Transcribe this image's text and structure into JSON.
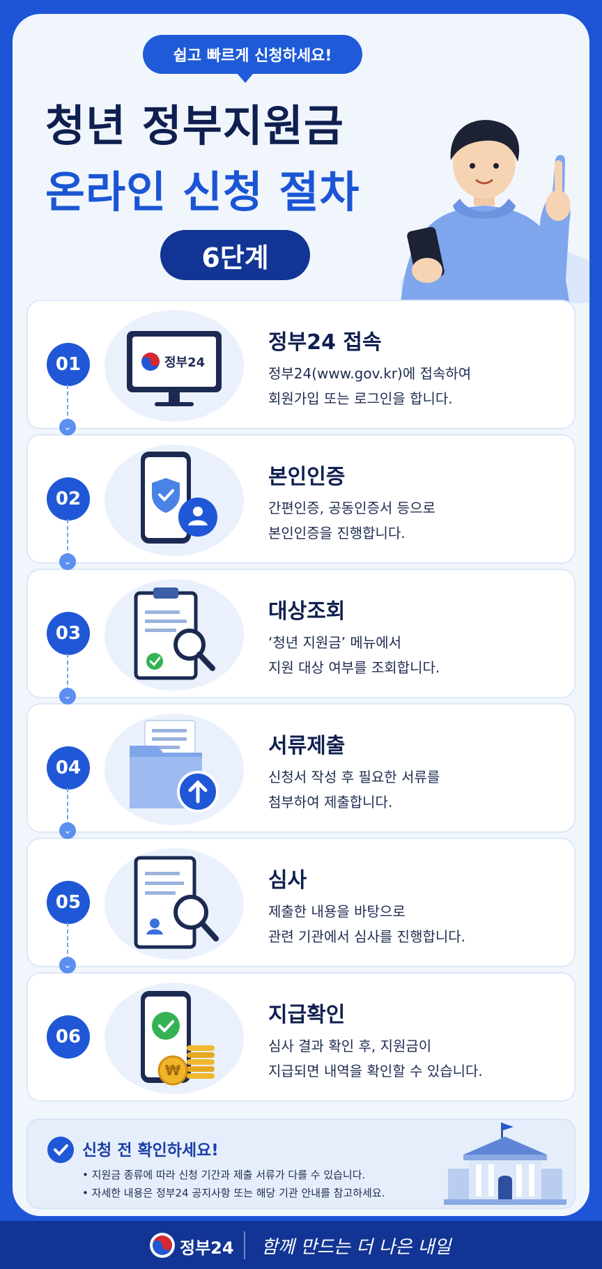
{
  "header": {
    "bubble": "쉽고 빠르게 신청하세요!",
    "title_line1": "청년 정부지원금",
    "title_line2": "온라인 신청 절차",
    "step_count": "6단계"
  },
  "steps": [
    {
      "num": "01",
      "title": "정부24 접속",
      "desc1": "정부24(www.gov.kr)에 접속하여",
      "desc2": "회원가입 또는 로그인을 합니다.",
      "icon": "monitor-icon",
      "screen_text": "정부24"
    },
    {
      "num": "02",
      "title": "본인인증",
      "desc1": "간편인증, 공동인증서 등으로",
      "desc2": "본인인증을 진행합니다.",
      "icon": "phone-shield-icon"
    },
    {
      "num": "03",
      "title": "대상조회",
      "desc1": "‘청년 지원금’ 메뉴에서",
      "desc2": "지원 대상 여부를 조회합니다.",
      "icon": "clipboard-search-icon"
    },
    {
      "num": "04",
      "title": "서류제출",
      "desc1": "신청서 작성 후 필요한 서류를",
      "desc2": "첨부하여 제출합니다.",
      "icon": "folder-upload-icon"
    },
    {
      "num": "05",
      "title": "심사",
      "desc1": "제출한 내용을 바탕으로",
      "desc2": "관련 기관에서 심사를 진행합니다.",
      "icon": "document-search-icon"
    },
    {
      "num": "06",
      "title": "지급확인",
      "desc1": "심사 결과 확인 후, 지원금이",
      "desc2": "지급되면 내역을 확인할 수 있습니다.",
      "icon": "phone-coins-icon",
      "coin_symbol": "₩"
    }
  ],
  "notice": {
    "title": "신청 전 확인하세요!",
    "line1": "• 지원금 종류에 따라 신청 기간과 제출 서류가 다를 수 있습니다.",
    "line2": "• 자세한 내용은 정부24 공지사항 또는 해당 기관 안내를 참고하세요."
  },
  "footer": {
    "brand": "정부24",
    "slogan": "함께 만드는 더 나은 내일"
  },
  "colors": {
    "primary": "#1f57d6",
    "navy": "#123494",
    "title_dark": "#0f1f4f",
    "card_bg": "#f1f6fd"
  }
}
